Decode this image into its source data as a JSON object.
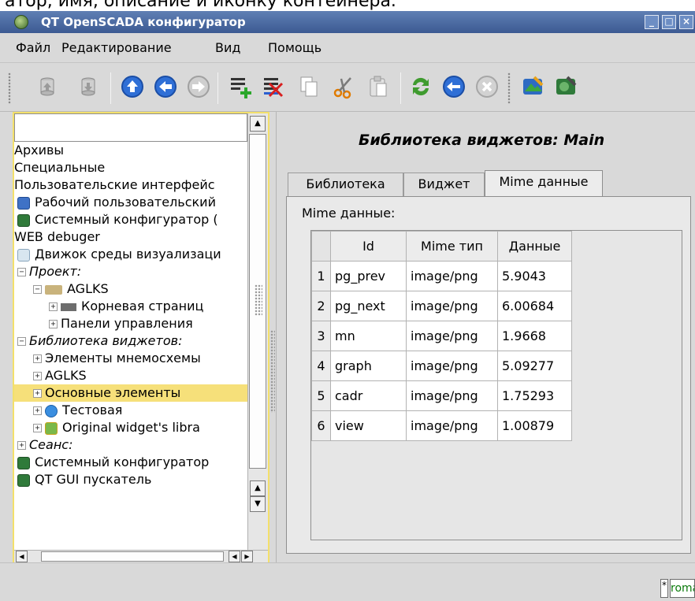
{
  "doc_text": "атор, имя, описание и иконку контейнера.",
  "window": {
    "title": "QT OpenSCADA конфигуратор",
    "controls": {
      "minimize": "_",
      "maximize": "□",
      "close": "×"
    }
  },
  "menu": [
    "Файл",
    "Редактирование",
    "Вид",
    "Помощь"
  ],
  "toolbar_icons": [
    "db-load-icon",
    "db-save-icon",
    "go-up-icon",
    "go-back-icon",
    "go-forward-icon",
    "add-item-icon",
    "delete-item-icon",
    "copy-icon",
    "cut-icon",
    "paste-icon",
    "refresh-icon",
    "start-icon",
    "stop-icon",
    "vision-icon",
    "system-configurator-icon"
  ],
  "tree": {
    "items": [
      {
        "label": "Архивы"
      },
      {
        "label": "Специальные"
      },
      {
        "label": "Пользовательские интерфейс"
      },
      {
        "label": "Рабочий пользовательский"
      },
      {
        "label": "Системный конфигуратор ("
      },
      {
        "label": "WEB debuger"
      },
      {
        "label": "Движок среды визуализаци"
      },
      {
        "label": "Проект:"
      },
      {
        "label": "AGLKS"
      },
      {
        "label": "Корневая страниц"
      },
      {
        "label": "Панели управления"
      },
      {
        "label": "Библиотека виджетов:"
      },
      {
        "label": "Элементы мнемосхемы"
      },
      {
        "label": "AGLKS"
      },
      {
        "label": "Основные элементы"
      },
      {
        "label": "Тестовая"
      },
      {
        "label": "Original widget's libra"
      },
      {
        "label": "Сеанс:"
      },
      {
        "label": "Системный конфигуратор"
      },
      {
        "label": "QT GUI пускатель"
      }
    ],
    "selected_index": 14
  },
  "panel": {
    "title": "Библиотека виджетов: Main",
    "tabs": [
      "Библиотека",
      "Виджет",
      "Mime данные"
    ],
    "active_tab": 2,
    "field_label": "Mime данные:",
    "columns": [
      "Id",
      "Mime тип",
      "Данные"
    ],
    "rows": [
      {
        "n": "1",
        "id": "pg_prev",
        "type": "image/png",
        "data": "5.9043"
      },
      {
        "n": "2",
        "id": "pg_next",
        "type": "image/png",
        "data": "6.00684"
      },
      {
        "n": "3",
        "id": "mn",
        "type": "image/png",
        "data": "1.9668"
      },
      {
        "n": "4",
        "id": "graph",
        "type": "image/png",
        "data": "5.09277"
      },
      {
        "n": "5",
        "id": "cadr",
        "type": "image/png",
        "data": "1.75293"
      },
      {
        "n": "6",
        "id": "view",
        "type": "image/png",
        "data": "1.00879"
      }
    ]
  },
  "status": {
    "modified_flag": "*",
    "user": "roman"
  },
  "colors": {
    "titlebar": "#4a6aa3",
    "selection": "#f6e07a",
    "focus_border": "#f3e06b",
    "status_user": "#0a7a0a"
  }
}
